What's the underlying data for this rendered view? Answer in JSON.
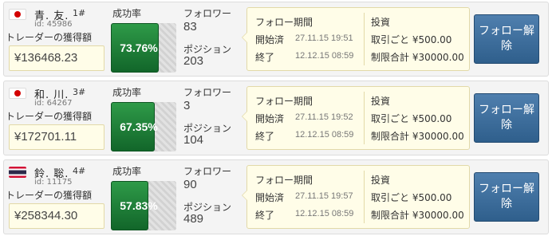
{
  "labels": {
    "earnings": "トレーダーの獲得額",
    "success_rate": "成功率",
    "followers": "フォロワー",
    "positions": "ポジション",
    "follow_period": "フォロー期間",
    "start": "開始済",
    "end": "終了",
    "invest": "投資",
    "unfollow_button": "フォロー解除"
  },
  "traders": [
    {
      "flag": "japan-flag",
      "name": "青. 友.",
      "rank": "1#",
      "id": "id: 45986",
      "earnings": "¥136468.23",
      "success_rate": "73.76%",
      "success_rate_fraction": 0.7376,
      "followers": "83",
      "positions": "203",
      "start": "27.11.15 19:51",
      "end": "12.12.15 08:59",
      "per_trade": "取引ごと ¥500.00",
      "limit": "制限合計 ¥30000.00"
    },
    {
      "flag": "japan-flag",
      "name": "和. 川.",
      "rank": "3#",
      "id": "id: 64267",
      "earnings": "¥172701.11",
      "success_rate": "67.35%",
      "success_rate_fraction": 0.6735,
      "followers": "3",
      "positions": "104",
      "start": "27.11.15 19:52",
      "end": "12.12.15 08:59",
      "per_trade": "取引ごと ¥500.00",
      "limit": "制限合計 ¥30000.00"
    },
    {
      "flag": "thailand-flag",
      "name": "鈴. 聡.",
      "rank": "4#",
      "id": "id: 11175",
      "earnings": "¥258344.30",
      "success_rate": "57.83%",
      "success_rate_fraction": 0.5783,
      "followers": "90",
      "positions": "489",
      "start": "27.11.15 19:57",
      "end": "12.12.15 08:59",
      "per_trade": "取引ごと ¥500.00",
      "limit": "制限合計 ¥30000.00"
    }
  ]
}
